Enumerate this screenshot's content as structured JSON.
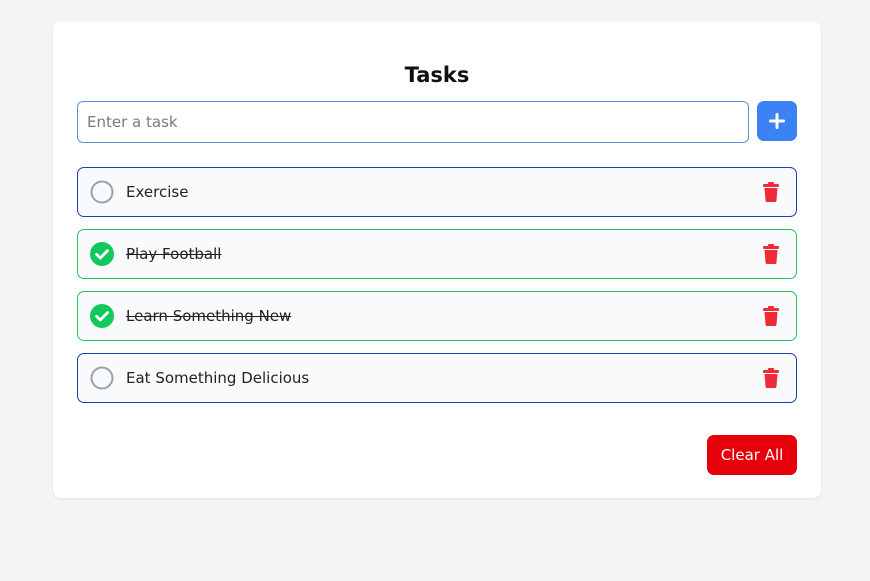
{
  "header": {
    "title": "Tasks"
  },
  "input": {
    "placeholder": "Enter a task",
    "value": ""
  },
  "add_button": {
    "icon": "plus-icon"
  },
  "tasks": [
    {
      "label": "Exercise",
      "completed": false
    },
    {
      "label": "Play Football",
      "completed": true
    },
    {
      "label": "Learn Something New",
      "completed": true
    },
    {
      "label": "Eat Something Delicious",
      "completed": false
    }
  ],
  "clear_button": {
    "label": "Clear All"
  },
  "colors": {
    "accent": "#3b82f6",
    "danger": "#e5000a",
    "trash": "#ef2b3a",
    "done_border": "#22c55e",
    "pending_border": "#1e40af",
    "check_fill": "#10c95a",
    "circle_stroke": "#9aa1ad"
  }
}
